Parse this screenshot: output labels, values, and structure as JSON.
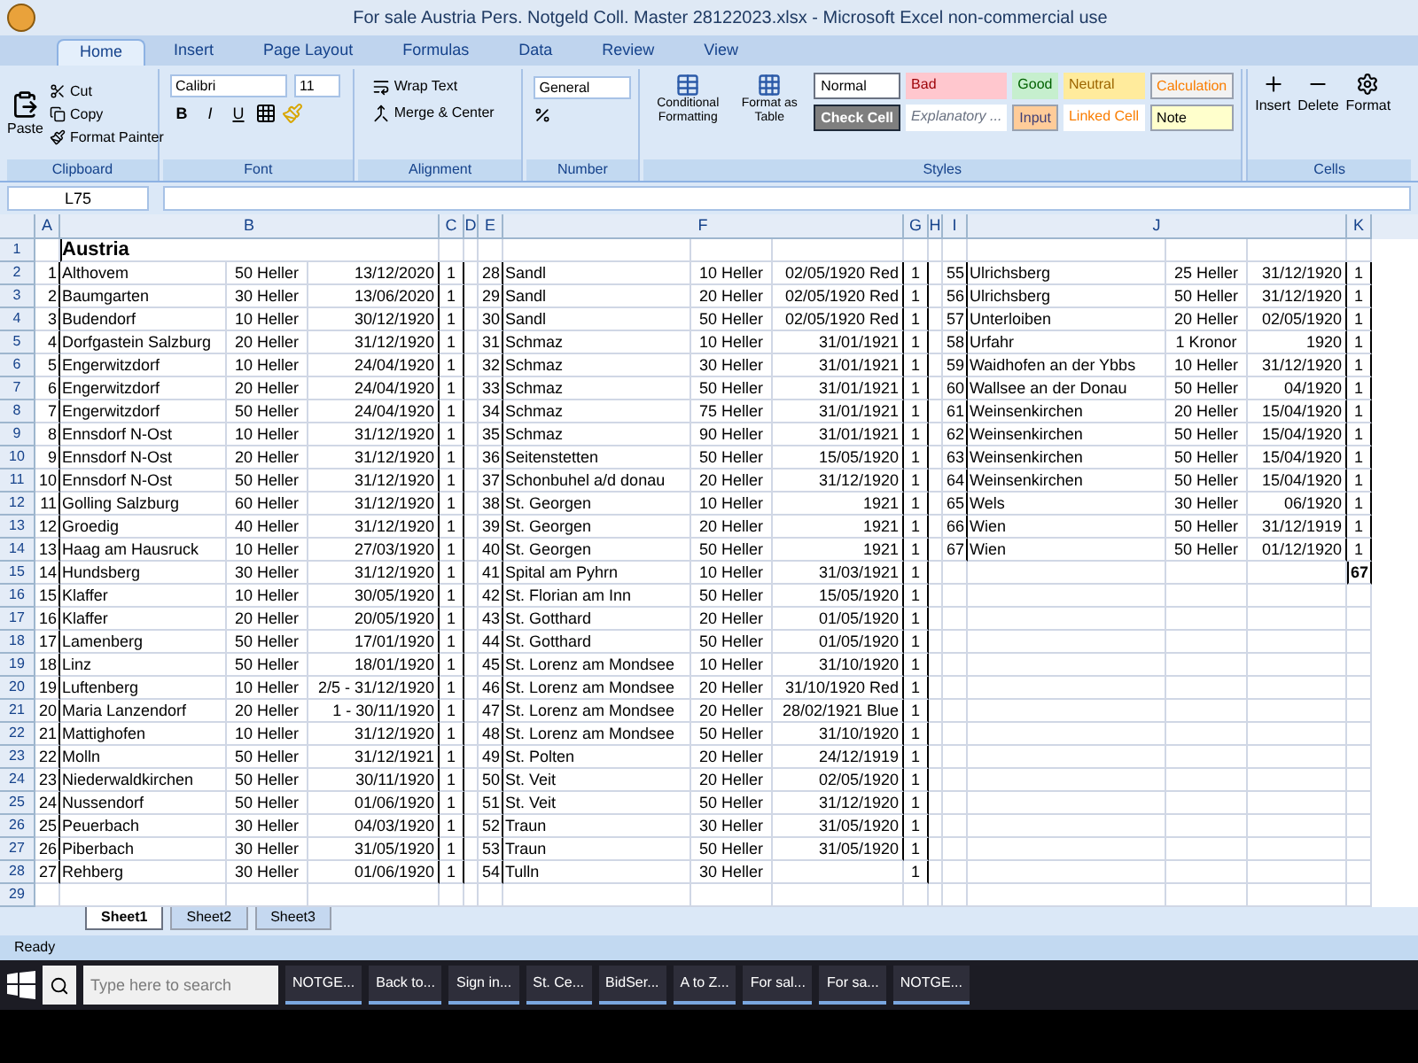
{
  "window": {
    "title": "For sale   Austria   Pers. Notgeld Coll. Master 28122023.xlsx - Microsoft Excel non-commercial use"
  },
  "ribbon_tabs": [
    {
      "label": "Home",
      "selected": true
    },
    {
      "label": "Insert",
      "selected": false
    },
    {
      "label": "Page Layout",
      "selected": false
    },
    {
      "label": "Formulas",
      "selected": false
    },
    {
      "label": "Data",
      "selected": false
    },
    {
      "label": "Review",
      "selected": false
    },
    {
      "label": "View",
      "selected": false
    }
  ],
  "clipboard": {
    "label": "Clipboard",
    "paste": "Paste",
    "buttons": [
      "Cut",
      "Copy",
      "Format Painter"
    ]
  },
  "font": {
    "label": "Font",
    "name": "Calibri",
    "size": "11",
    "buttons": [
      "B",
      "I",
      "U"
    ]
  },
  "alignment": {
    "label": "Alignment",
    "buttons": [
      "Wrap Text",
      "Merge & Center"
    ]
  },
  "number": {
    "label": "Number",
    "format": "General"
  },
  "styles": {
    "label": "Styles",
    "buttons": [
      "Conditional Formatting",
      "Format as Table"
    ],
    "cell_styles": [
      {
        "label": "Normal",
        "kind": "normal"
      },
      {
        "label": "Bad",
        "kind": "bad"
      },
      {
        "label": "Good",
        "kind": "good"
      },
      {
        "label": "Neutral",
        "kind": "neutral"
      },
      {
        "label": "Calculation",
        "kind": "calculation"
      },
      {
        "label": "Check Cell",
        "kind": "check"
      },
      {
        "label": "Explanatory ...",
        "kind": "explanatory"
      },
      {
        "label": "Input",
        "kind": "input"
      },
      {
        "label": "Linked Cell",
        "kind": "linked"
      },
      {
        "label": "Note",
        "kind": "note"
      }
    ]
  },
  "cells": {
    "label": "Cells",
    "buttons": [
      "Insert",
      "Delete",
      "Format"
    ]
  },
  "formula_bar": {
    "name_box": "L75"
  },
  "columns": [
    "A",
    "B",
    "C",
    "D",
    "E",
    "F",
    "G",
    "H",
    "I",
    "J",
    "K"
  ],
  "row_numbers": [
    "1",
    "2",
    "3",
    "4",
    "5",
    "6",
    "7",
    "8",
    "9",
    "10",
    "11",
    "12",
    "13",
    "14",
    "15",
    "16",
    "17",
    "18",
    "19",
    "20",
    "21",
    "22",
    "23",
    "24",
    "25",
    "26",
    "27",
    "28",
    "29"
  ],
  "heading": "Austria",
  "blocks": [
    {
      "entries": [
        {
          "no": "1",
          "place": "Althovem",
          "value": "50 Heller",
          "date": "13/12/2020",
          "count": "1"
        },
        {
          "no": "2",
          "place": "Baumgarten",
          "value": "30 Heller",
          "date": "13/06/2020",
          "count": "1"
        },
        {
          "no": "3",
          "place": "Budendorf",
          "value": "10 Heller",
          "date": "30/12/1920",
          "count": "1"
        },
        {
          "no": "4",
          "place": "Dorfgastein  Salzburg",
          "value": "20 Heller",
          "date": "31/12/1920",
          "count": "1"
        },
        {
          "no": "5",
          "place": "Engerwitzdorf",
          "value": "10 Heller",
          "date": "24/04/1920",
          "count": "1"
        },
        {
          "no": "6",
          "place": "Engerwitzdorf",
          "value": "20 Heller",
          "date": "24/04/1920",
          "count": "1"
        },
        {
          "no": "7",
          "place": "Engerwitzdorf",
          "value": "50 Heller",
          "date": "24/04/1920",
          "count": "1"
        },
        {
          "no": "8",
          "place": "Ennsdorf N-Ost",
          "value": "10 Heller",
          "date": "31/12/1920",
          "count": "1"
        },
        {
          "no": "9",
          "place": "Ennsdorf N-Ost",
          "value": "20 Heller",
          "date": "31/12/1920",
          "count": "1"
        },
        {
          "no": "10",
          "place": "Ennsdorf N-Ost",
          "value": "50 Heller",
          "date": "31/12/1920",
          "count": "1"
        },
        {
          "no": "11",
          "place": "Golling  Salzburg",
          "value": "60 Heller",
          "date": "31/12/1920",
          "count": "1"
        },
        {
          "no": "12",
          "place": "Groedig",
          "value": "40 Heller",
          "date": "31/12/1920",
          "count": "1"
        },
        {
          "no": "13",
          "place": "Haag am Hausruck",
          "value": "10 Heller",
          "date": "27/03/1920",
          "count": "1"
        },
        {
          "no": "14",
          "place": "Hundsberg",
          "value": "30 Heller",
          "date": "31/12/1920",
          "count": "1"
        },
        {
          "no": "15",
          "place": "Klaffer",
          "value": "10 Heller",
          "date": "30/05/1920",
          "count": "1"
        },
        {
          "no": "16",
          "place": "Klaffer",
          "value": "20 Heller",
          "date": "20/05/1920",
          "count": "1"
        },
        {
          "no": "17",
          "place": "Lamenberg",
          "value": "50 Heller",
          "date": "17/01/1920",
          "count": "1"
        },
        {
          "no": "18",
          "place": "Linz",
          "value": "50 Heller",
          "date": "18/01/1920",
          "count": "1"
        },
        {
          "no": "19",
          "place": "Luftenberg",
          "value": "10 Heller",
          "date": "2/5 -  31/12/1920",
          "count": "1"
        },
        {
          "no": "20",
          "place": "Maria Lanzendorf",
          "value": "20 Heller",
          "date": "1 - 30/11/1920",
          "count": "1"
        },
        {
          "no": "21",
          "place": "Mattighofen",
          "value": "10 Heller",
          "date": "31/12/1920",
          "count": "1"
        },
        {
          "no": "22",
          "place": "Molln",
          "value": "50 Heller",
          "date": "31/12/1921",
          "count": "1"
        },
        {
          "no": "23",
          "place": "Niederwaldkirchen",
          "value": "50 Heller",
          "date": "30/11/1920",
          "count": "1"
        },
        {
          "no": "24",
          "place": "Nussendorf",
          "value": "50 Heller",
          "date": "01/06/1920",
          "count": "1"
        },
        {
          "no": "25",
          "place": "Peuerbach",
          "value": "30 Heller",
          "date": "04/03/1920",
          "count": "1"
        },
        {
          "no": "26",
          "place": "Piberbach",
          "value": "30 Heller",
          "date": "31/05/1920",
          "count": "1"
        },
        {
          "no": "27",
          "place": "Rehberg",
          "value": "30 Heller",
          "date": "01/06/1920",
          "count": "1"
        }
      ]
    },
    {
      "entries": [
        {
          "no": "28",
          "place": "Sandl",
          "value": "10 Heller",
          "date": "02/05/1920 Red",
          "count": "1"
        },
        {
          "no": "29",
          "place": "Sandl",
          "value": "20 Heller",
          "date": "02/05/1920 Red",
          "count": "1"
        },
        {
          "no": "30",
          "place": "Sandl",
          "value": "50 Heller",
          "date": "02/05/1920 Red",
          "count": "1"
        },
        {
          "no": "31",
          "place": "Schmaz",
          "value": "10 Heller",
          "date": "31/01/1921",
          "count": "1"
        },
        {
          "no": "32",
          "place": "Schmaz",
          "value": "30 Heller",
          "date": "31/01/1921",
          "count": "1"
        },
        {
          "no": "33",
          "place": "Schmaz",
          "value": "50 Heller",
          "date": "31/01/1921",
          "count": "1"
        },
        {
          "no": "34",
          "place": "Schmaz",
          "value": "75 Heller",
          "date": "31/01/1921",
          "count": "1"
        },
        {
          "no": "35",
          "place": "Schmaz",
          "value": "90 Heller",
          "date": "31/01/1921",
          "count": "1"
        },
        {
          "no": "36",
          "place": "Seitenstetten",
          "value": "50 Heller",
          "date": "15/05/1920",
          "count": "1"
        },
        {
          "no": "37",
          "place": "Schonbuhel a/d donau",
          "value": "20 Heller",
          "date": "31/12/1920",
          "count": "1"
        },
        {
          "no": "38",
          "place": "St. Georgen",
          "value": "10 Heller",
          "date": "1921",
          "count": "1"
        },
        {
          "no": "39",
          "place": "St. Georgen",
          "value": "20 Heller",
          "date": "1921",
          "count": "1"
        },
        {
          "no": "40",
          "place": "St. Georgen",
          "value": "50 Heller",
          "date": "1921",
          "count": "1"
        },
        {
          "no": "41",
          "place": "Spital am Pyhrn",
          "value": "10 Heller",
          "date": "31/03/1921",
          "count": "1"
        },
        {
          "no": "42",
          "place": "St. Florian am Inn",
          "value": "50 Heller",
          "date": "15/05/1920",
          "count": "1"
        },
        {
          "no": "43",
          "place": "St. Gotthard",
          "value": "20 Heller",
          "date": "01/05/1920",
          "count": "1"
        },
        {
          "no": "44",
          "place": "St. Gotthard",
          "value": "50 Heller",
          "date": "01/05/1920",
          "count": "1"
        },
        {
          "no": "45",
          "place": "St. Lorenz am Mondsee",
          "value": "10 Heller",
          "date": "31/10/1920",
          "count": "1"
        },
        {
          "no": "46",
          "place": "St. Lorenz am Mondsee",
          "value": "20 Heller",
          "date": "31/10/1920  Red",
          "count": "1"
        },
        {
          "no": "47",
          "place": "St. Lorenz am Mondsee",
          "value": "20 Heller",
          "date": "28/02/1921  Blue",
          "count": "1"
        },
        {
          "no": "48",
          "place": "St. Lorenz am Mondsee",
          "value": "50 Heller",
          "date": "31/10/1920",
          "count": "1"
        },
        {
          "no": "49",
          "place": "St. Polten",
          "value": "20 Heller",
          "date": "24/12/1919",
          "count": "1"
        },
        {
          "no": "50",
          "place": "St. Veit",
          "value": "20 Heller",
          "date": "02/05/1920",
          "count": "1"
        },
        {
          "no": "51",
          "place": "St. Veit",
          "value": "50 Heller",
          "date": "31/12/1920",
          "count": "1"
        },
        {
          "no": "52",
          "place": "Traun",
          "value": "30 Heller",
          "date": "31/05/1920",
          "count": "1"
        },
        {
          "no": "53",
          "place": "Traun",
          "value": "50 Heller",
          "date": "31/05/1920",
          "count": "1"
        },
        {
          "no": "54",
          "place": "Tulln",
          "value": "30 Heller",
          "count": "1"
        }
      ]
    },
    {
      "entries": [
        {
          "no": "55",
          "place": "Ulrichsberg",
          "value": "25 Heller",
          "date": "31/12/1920",
          "count": "1"
        },
        {
          "no": "56",
          "place": "Ulrichsberg",
          "value": "50 Heller",
          "date": "31/12/1920",
          "count": "1"
        },
        {
          "no": "57",
          "place": "Unterloiben",
          "value": "20 Heller",
          "date": "02/05/1920",
          "count": "1"
        },
        {
          "no": "58",
          "place": "Urfahr",
          "value": "1 Kronor",
          "date": "1920",
          "count": "1"
        },
        {
          "no": "59",
          "place": "Waidhofen an der Ybbs",
          "value": "10 Heller",
          "date": "31/12/1920",
          "count": "1"
        },
        {
          "no": "60",
          "place": "Wallsee an der Donau",
          "value": "50 Heller",
          "date": "04/1920",
          "count": "1"
        },
        {
          "no": "61",
          "place": "Weinsenkirchen",
          "value": "20 Heller",
          "date": "15/04/1920",
          "count": "1"
        },
        {
          "no": "62",
          "place": "Weinsenkirchen",
          "value": "50 Heller",
          "date": "15/04/1920",
          "count": "1"
        },
        {
          "no": "63",
          "place": "Weinsenkirchen",
          "value": "50 Heller",
          "date": "15/04/1920",
          "count": "1"
        },
        {
          "no": "64",
          "place": "Weinsenkirchen",
          "value": "50 Heller",
          "date": "15/04/1920",
          "count": "1"
        },
        {
          "no": "65",
          "place": "Wels",
          "value": "30 Heller",
          "date": "06/1920",
          "count": "1"
        },
        {
          "no": "66",
          "place": "Wien",
          "value": "50 Heller",
          "date": "31/12/1919",
          "count": "1"
        },
        {
          "no": "67",
          "place": "Wien",
          "value": "50 Heller",
          "date": "01/12/1920",
          "count": "1"
        }
      ],
      "total": "67"
    }
  ],
  "sheet_tabs": [
    {
      "label": "Sheet1",
      "selected": true
    },
    {
      "label": "Sheet2",
      "selected": false
    },
    {
      "label": "Sheet3",
      "selected": false
    }
  ],
  "status": "Ready",
  "taskbar": {
    "search_placeholder": "Type here to search",
    "apps": [
      "NOTGE...",
      "Back to...",
      "Sign in...",
      "St. Ce...",
      "BidSer...",
      "A to Z...",
      "For sal...",
      "For sa...",
      "NOTGE..."
    ]
  }
}
